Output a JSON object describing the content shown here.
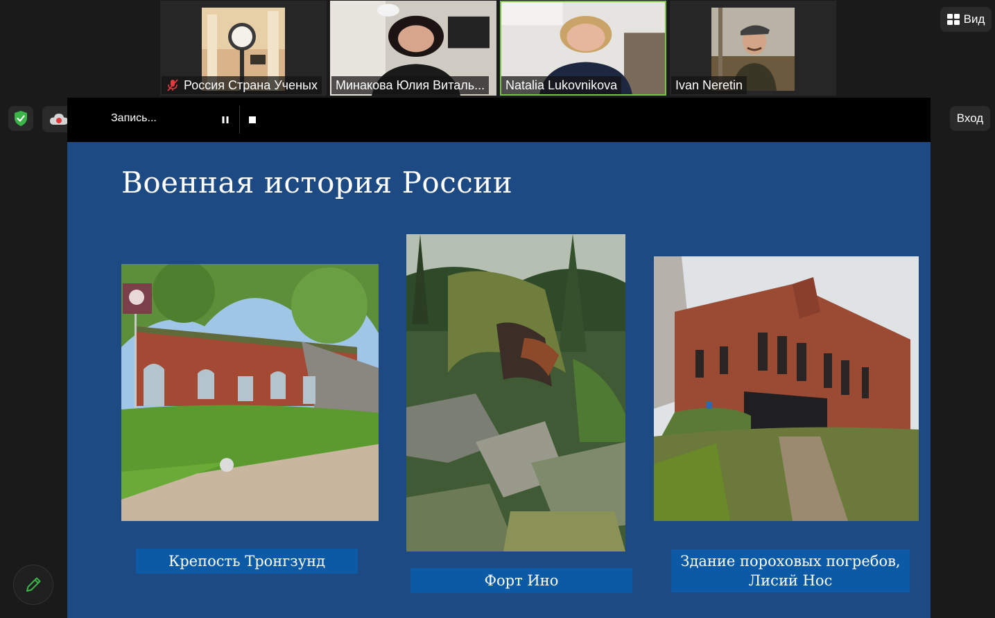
{
  "participants": [
    {
      "name": "Россия Страна Ученых",
      "muted": true
    },
    {
      "name": "Минакова Юлия Виталь...",
      "muted": false
    },
    {
      "name": "Natalia Lukovnikova",
      "muted": false,
      "speaking": true
    },
    {
      "name": "Ivan Neretin",
      "muted": false
    }
  ],
  "top_controls": {
    "view_label": "Вид",
    "exit_label": "Вход"
  },
  "recording": {
    "label": "Запись..."
  },
  "slide": {
    "title": "Военная история России",
    "photos": [
      {
        "caption": "Крепость Тронгзунд"
      },
      {
        "caption": "Форт Ино"
      },
      {
        "caption_line1": "Здание пороховых погребов,",
        "caption_line2": "Лисий Нос"
      }
    ]
  },
  "colors": {
    "accent_speaking": "#7dc142",
    "slide_bg": "#1d4a82",
    "caption_bg": "#0c5aa6",
    "shield": "#3bb54a"
  },
  "icons": [
    "mic-off-icon",
    "gallery-view-icon",
    "shield-check-icon",
    "cloud-record-icon",
    "pause-icon",
    "stop-icon",
    "pencil-icon"
  ]
}
